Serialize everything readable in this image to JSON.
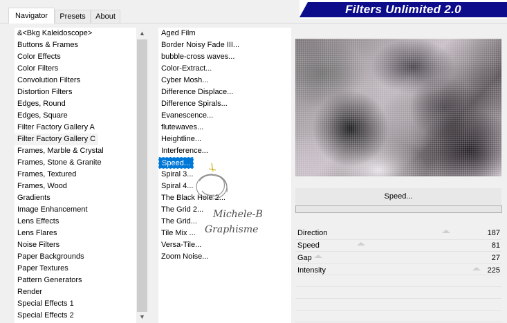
{
  "tabs": [
    "Navigator",
    "Presets",
    "About"
  ],
  "banner": {
    "title": "Filters Unlimited 2.0"
  },
  "categories": [
    "&<Bkg Kaleidoscope>",
    "Buttons & Frames",
    "Color Effects",
    "Color Filters",
    "Convolution Filters",
    "Distortion Filters",
    "Edges, Round",
    "Edges, Square",
    "Filter Factory Gallery A",
    "Filter Factory Gallery C",
    "Frames, Marble & Crystal",
    "Frames, Stone & Granite",
    "Frames, Textured",
    "Frames, Wood",
    "Gradients",
    "Image Enhancement",
    "Lens Effects",
    "Lens Flares",
    "Noise Filters",
    "Paper Backgrounds",
    "Paper Textures",
    "Pattern Generators",
    "Render",
    "Special Effects 1",
    "Special Effects 2"
  ],
  "filters": [
    "Aged Film",
    "Border Noisy Fade III...",
    "bubble-cross waves...",
    "Color-Extract...",
    "Cyber Mosh...",
    "Difference Displace...",
    "Difference Spirals...",
    "Evanescence...",
    "flutewaves...",
    "Heightline...",
    "Interference...",
    "Speed...",
    "Spiral 3...",
    "Spiral 4...",
    "The Black Hole 2...",
    "The Grid 2...",
    "The Grid...",
    "Tile Mix ...",
    "Versa-Tile...",
    "Zoom Noise..."
  ],
  "selected_filter": "Speed...",
  "controls": [
    {
      "label": "Direction",
      "value": "187",
      "level": 0.73
    },
    {
      "label": "Speed",
      "value": "81",
      "level": 0.32
    },
    {
      "label": "Gap",
      "value": "27",
      "level": 0.11
    },
    {
      "label": "Intensity",
      "value": "225",
      "level": 0.88
    }
  ],
  "watermark": {
    "line1": "Michele-B",
    "line2": "Graphisme"
  },
  "colors": {
    "banner": "#0d0d8c",
    "selection": "#0078d7"
  },
  "icons": {
    "scroll_up": "▲",
    "scroll_down": "▼"
  }
}
